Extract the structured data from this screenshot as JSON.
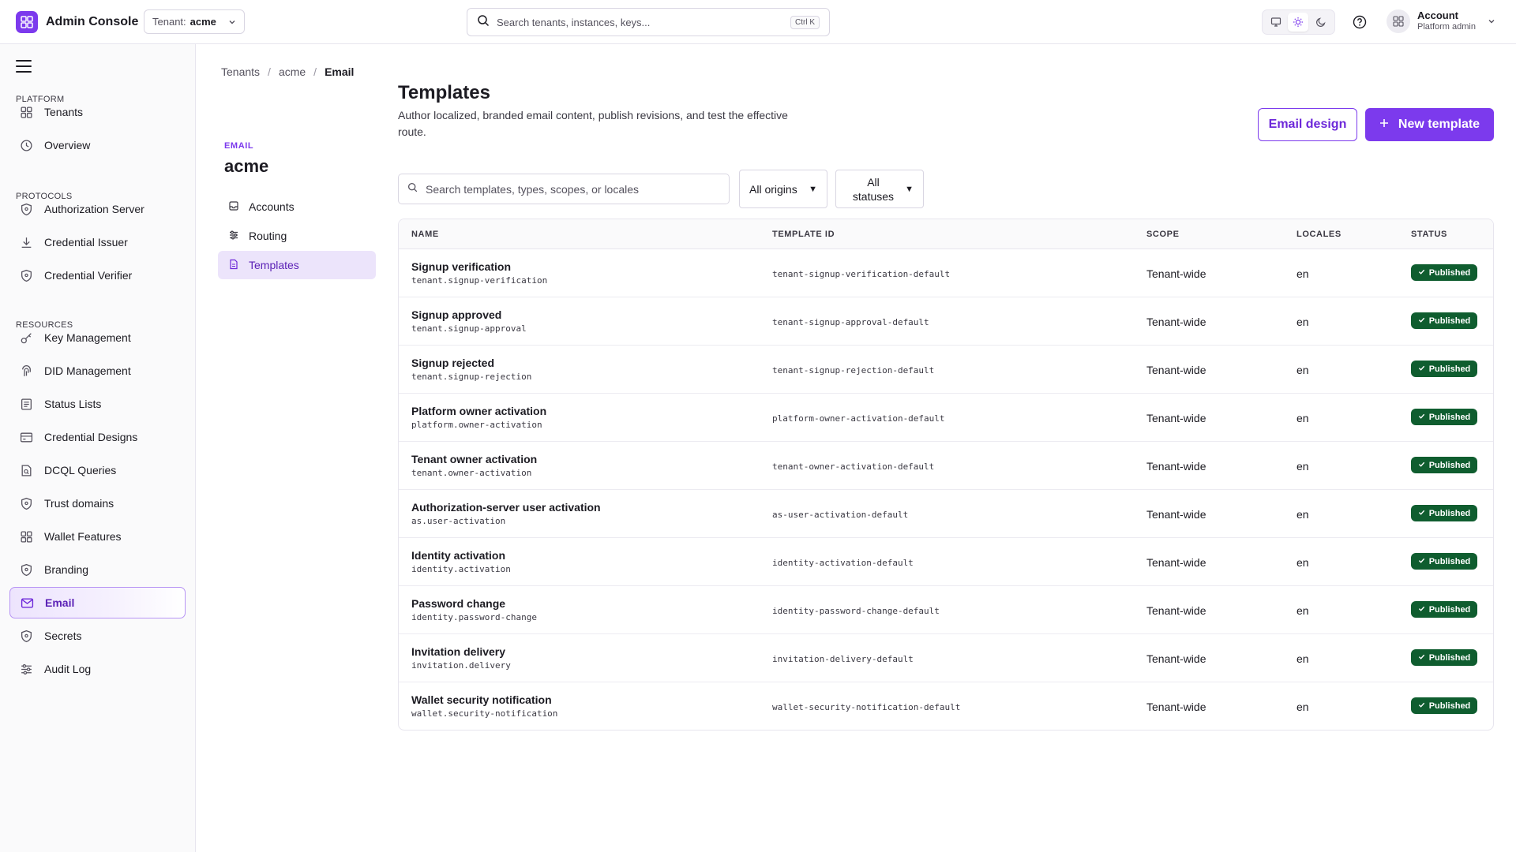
{
  "app": {
    "title": "Admin Console"
  },
  "tenant": {
    "label": "Tenant:",
    "value": "acme"
  },
  "search": {
    "placeholder": "Search tenants, instances, keys...",
    "shortcut": "Ctrl K"
  },
  "account": {
    "name": "Account",
    "role": "Platform admin"
  },
  "colors": {
    "accent": "#7c3aed",
    "published": "#0f5d2f"
  },
  "sidebar": {
    "sections": [
      {
        "title": "PLATFORM",
        "items": [
          {
            "label": "Tenants",
            "icon": "grid-icon"
          },
          {
            "label": "Overview",
            "icon": "clock-icon"
          }
        ]
      },
      {
        "title": "PROTOCOLS",
        "items": [
          {
            "label": "Authorization Server",
            "icon": "shield-icon"
          },
          {
            "label": "Credential Issuer",
            "icon": "download-icon"
          },
          {
            "label": "Credential Verifier",
            "icon": "shield-icon"
          }
        ]
      },
      {
        "title": "RESOURCES",
        "items": [
          {
            "label": "Key Management",
            "icon": "key-icon"
          },
          {
            "label": "DID Management",
            "icon": "fingerprint-icon"
          },
          {
            "label": "Status Lists",
            "icon": "list-icon"
          },
          {
            "label": "Credential Designs",
            "icon": "card-icon"
          },
          {
            "label": "DCQL Queries",
            "icon": "query-icon"
          },
          {
            "label": "Trust domains",
            "icon": "shield-icon"
          },
          {
            "label": "Wallet Features",
            "icon": "grid-icon"
          },
          {
            "label": "Branding",
            "icon": "shield-icon"
          },
          {
            "label": "Email",
            "icon": "mail-icon",
            "active": true
          },
          {
            "label": "Secrets",
            "icon": "shield-icon"
          },
          {
            "label": "Audit Log",
            "icon": "sliders-icon"
          }
        ]
      }
    ]
  },
  "breadcrumb": [
    "Tenants",
    "acme",
    "Email"
  ],
  "subnav": {
    "eyebrow": "EMAIL",
    "title": "acme",
    "items": [
      {
        "label": "Accounts",
        "icon": "inbox-icon"
      },
      {
        "label": "Routing",
        "icon": "sliders-icon"
      },
      {
        "label": "Templates",
        "icon": "file-icon",
        "active": true
      }
    ]
  },
  "page": {
    "title": "Templates",
    "description": "Author localized, branded email content, publish revisions, and test the effective route.",
    "email_design_label": "Email design",
    "new_template_label": "New template"
  },
  "filters": {
    "search_placeholder": "Search templates, types, scopes, or locales",
    "origin": "All origins",
    "status": "All statuses"
  },
  "table": {
    "columns": [
      "NAME",
      "TEMPLATE ID",
      "SCOPE",
      "LOCALES",
      "STATUS"
    ],
    "rows": [
      {
        "name": "Signup verification",
        "key": "tenant.signup-verification",
        "id": "tenant-signup-verification-default",
        "scope": "Tenant-wide",
        "locales": "en",
        "status": "Published"
      },
      {
        "name": "Signup approved",
        "key": "tenant.signup-approval",
        "id": "tenant-signup-approval-default",
        "scope": "Tenant-wide",
        "locales": "en",
        "status": "Published"
      },
      {
        "name": "Signup rejected",
        "key": "tenant.signup-rejection",
        "id": "tenant-signup-rejection-default",
        "scope": "Tenant-wide",
        "locales": "en",
        "status": "Published"
      },
      {
        "name": "Platform owner activation",
        "key": "platform.owner-activation",
        "id": "platform-owner-activation-default",
        "scope": "Tenant-wide",
        "locales": "en",
        "status": "Published"
      },
      {
        "name": "Tenant owner activation",
        "key": "tenant.owner-activation",
        "id": "tenant-owner-activation-default",
        "scope": "Tenant-wide",
        "locales": "en",
        "status": "Published"
      },
      {
        "name": "Authorization-server user activation",
        "key": "as.user-activation",
        "id": "as-user-activation-default",
        "scope": "Tenant-wide",
        "locales": "en",
        "status": "Published"
      },
      {
        "name": "Identity activation",
        "key": "identity.activation",
        "id": "identity-activation-default",
        "scope": "Tenant-wide",
        "locales": "en",
        "status": "Published"
      },
      {
        "name": "Password change",
        "key": "identity.password-change",
        "id": "identity-password-change-default",
        "scope": "Tenant-wide",
        "locales": "en",
        "status": "Published"
      },
      {
        "name": "Invitation delivery",
        "key": "invitation.delivery",
        "id": "invitation-delivery-default",
        "scope": "Tenant-wide",
        "locales": "en",
        "status": "Published"
      },
      {
        "name": "Wallet security notification",
        "key": "wallet.security-notification",
        "id": "wallet-security-notification-default",
        "scope": "Tenant-wide",
        "locales": "en",
        "status": "Published"
      }
    ]
  }
}
